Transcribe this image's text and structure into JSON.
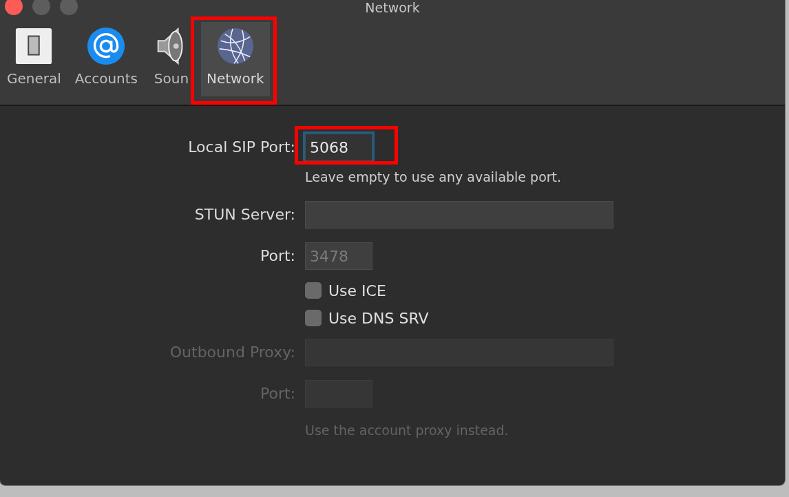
{
  "window": {
    "title": "Network"
  },
  "tabs": [
    {
      "label": "General",
      "kind": "switch",
      "selected": false,
      "highlighted": false
    },
    {
      "label": "Accounts",
      "kind": "at",
      "selected": false,
      "highlighted": false
    },
    {
      "label": "Soun",
      "kind": "speaker",
      "selected": false,
      "highlighted": false
    },
    {
      "label": "Network",
      "kind": "globe",
      "selected": true,
      "highlighted": true
    }
  ],
  "form": [
    {
      "kind": "short-field",
      "label": "Local SIP Port:",
      "value": "5068",
      "focused": true,
      "highlighted": true,
      "disabled": false
    },
    {
      "kind": "hint",
      "text": "Leave empty to use any available port.",
      "disabled": false
    },
    {
      "kind": "long-field",
      "label": "STUN Server:",
      "focused": false,
      "highlighted": false,
      "disabled": false
    },
    {
      "kind": "short-field",
      "label": "Port:",
      "placeholder": "3478",
      "focused": false,
      "highlighted": false,
      "disabled": false
    },
    {
      "kind": "checkbox",
      "label": "Use ICE",
      "checked": false
    },
    {
      "kind": "checkbox",
      "label": "Use DNS SRV",
      "checked": false
    },
    {
      "kind": "long-field",
      "label": "Outbound Proxy:",
      "focused": false,
      "highlighted": false,
      "disabled": true
    },
    {
      "kind": "short-field",
      "label": "Port:",
      "focused": false,
      "highlighted": false,
      "disabled": true
    },
    {
      "kind": "hint",
      "text": "Use the account proxy instead.",
      "disabled": true
    }
  ]
}
